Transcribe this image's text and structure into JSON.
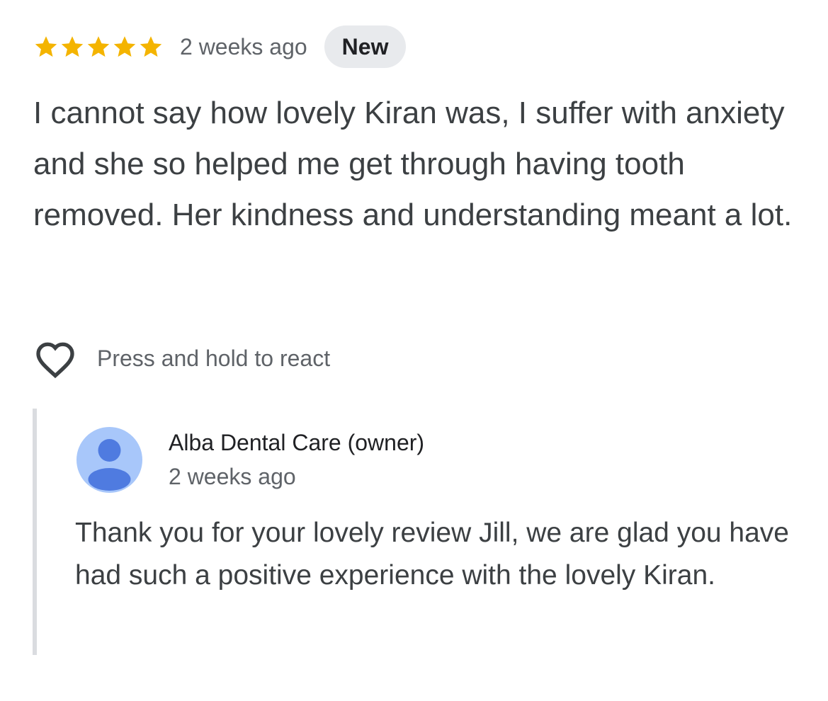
{
  "review": {
    "rating": 5,
    "rating_max": 5,
    "star_color": "#f4b400",
    "time_ago": "2 weeks ago",
    "badge": "New",
    "text": "I cannot say how lovely Kiran was, I suffer with anxiety and she so helped me get through having tooth removed. Her kindness and understanding meant a lot.",
    "react_icon": "heart-icon",
    "react_label": "Press and hold to react"
  },
  "owner_reply": {
    "avatar_icon": "person-avatar-icon",
    "avatar_colors": {
      "background": "#a8c7fa",
      "figure": "#4f7be0"
    },
    "name": "Alba Dental Care (owner)",
    "time_ago": "2 weeks ago",
    "text": "Thank you for your lovely review Jill, we are glad you have had such a positive experience with the lovely Kiran."
  }
}
